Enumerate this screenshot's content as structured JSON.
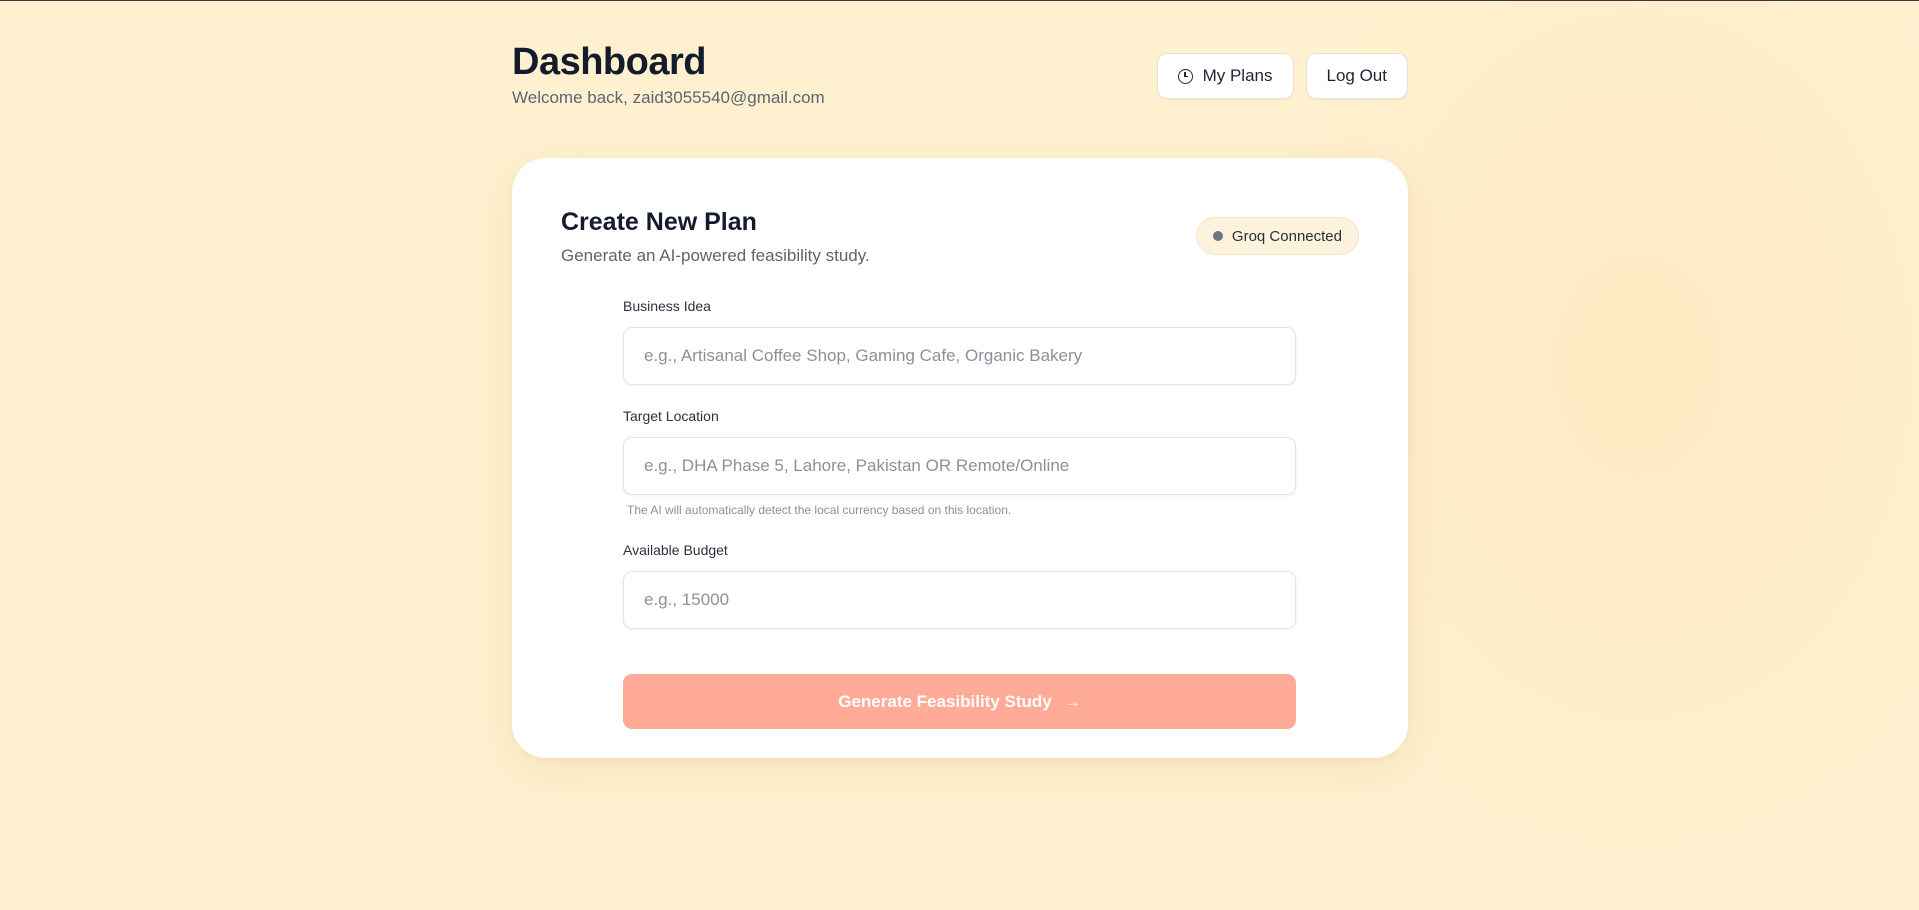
{
  "header": {
    "title": "Dashboard",
    "welcome": "Welcome back, zaid3055540@gmail.com",
    "my_plans_label": "My Plans",
    "logout_label": "Log Out"
  },
  "card": {
    "title": "Create New Plan",
    "subtitle": "Generate an AI-powered feasibility study.",
    "status": "Groq Connected"
  },
  "form": {
    "business_idea": {
      "label": "Business Idea",
      "placeholder": "e.g., Artisanal Coffee Shop, Gaming Cafe, Organic Bakery",
      "value": ""
    },
    "target_location": {
      "label": "Target Location",
      "placeholder": "e.g., DHA Phase 5, Lahore, Pakistan OR Remote/Online",
      "value": "",
      "hint": "The AI will automatically detect the local currency based on this location."
    },
    "budget": {
      "label": "Available Budget",
      "placeholder": "e.g., 15000",
      "value": ""
    },
    "submit_label": "Generate Feasibility Study",
    "submit_icon": "arrow-right-icon"
  },
  "colors": {
    "background": "#fff1cf",
    "accent_button": "#ffab98",
    "status_dot": "#6f7480"
  }
}
